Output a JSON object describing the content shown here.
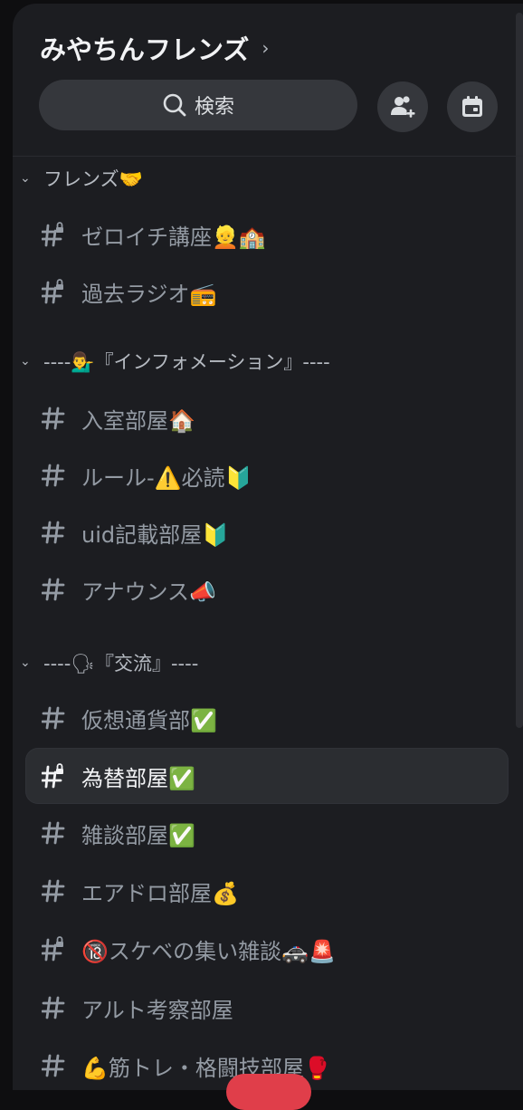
{
  "server": {
    "name": "みやちんフレンズ"
  },
  "search": {
    "label": "検索"
  },
  "icons": {
    "search": "search-icon",
    "invite": "add-member-icon",
    "events": "calendar-icon",
    "hash": "hash-icon",
    "locked_hash": "locked-hash-icon",
    "chevron": "chevron-right-icon",
    "caret": "chevron-down-icon"
  },
  "categories": [
    {
      "label": "フレンズ🤝"
    },
    {
      "label": "----💁‍♂️『インフォメーション』----"
    },
    {
      "label": "----🗣『交流』----"
    }
  ],
  "channels": [
    {
      "label": "ゼロイチ講座👱🏫",
      "locked": true
    },
    {
      "label": "過去ラジオ📻",
      "locked": true
    },
    {
      "label": "入室部屋🏠",
      "locked": false
    },
    {
      "label": "ルール-⚠️必読🔰",
      "locked": false
    },
    {
      "label": "uid記載部屋🔰",
      "locked": false
    },
    {
      "label": "アナウンス📣",
      "locked": false
    },
    {
      "label": "仮想通貨部✅",
      "locked": false
    },
    {
      "label": "為替部屋✅",
      "locked": true,
      "active": true
    },
    {
      "label": "雑談部屋✅",
      "locked": false
    },
    {
      "label": "エアドロ部屋💰",
      "locked": false
    },
    {
      "label": "🔞スケベの集い雑談🚓🚨",
      "locked": true
    },
    {
      "label": "アルト考察部屋",
      "locked": false
    },
    {
      "label": "💪筋トレ・格闘技部屋🥊",
      "locked": false
    }
  ],
  "colors": {
    "background": "#1c1d21",
    "text_muted": "#949ba4",
    "text_active": "#f2f3f5",
    "button_bg": "#35373c",
    "accent_red": "#e03e4a"
  }
}
